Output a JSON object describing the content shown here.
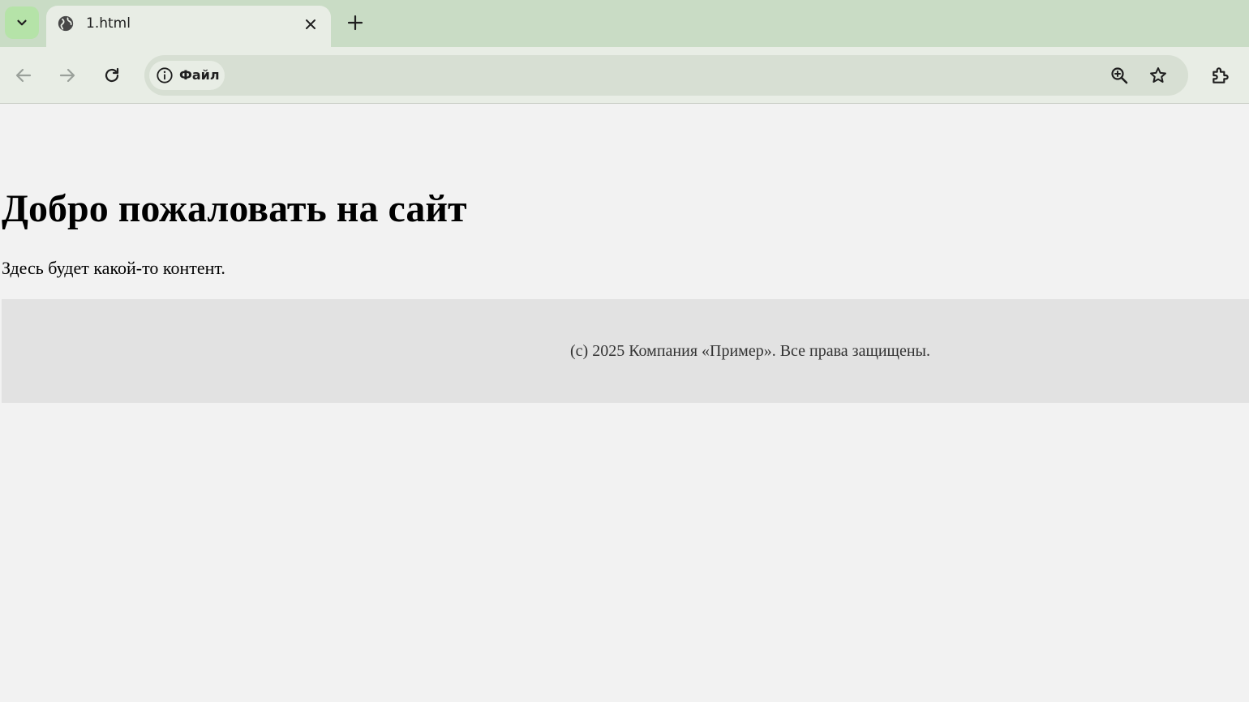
{
  "browser": {
    "tab": {
      "title": "1.html"
    },
    "address_bar": {
      "site_chip_label": "Файл"
    }
  },
  "page": {
    "heading": "Добро пожаловать на сайт",
    "paragraph": "Здесь будет какой-то контент.",
    "footer": "(c) 2025 Компания «Пример». Все права защищены."
  },
  "colors": {
    "tabstrip": "#c9dcc5",
    "toolbar": "#e8ede5",
    "omnibox": "#d7dfd3",
    "page_bg": "#f2f2f2",
    "footer_bg": "#e2e2e2"
  },
  "icons": [
    "chevron-down-icon",
    "globe-icon",
    "close-icon",
    "plus-icon",
    "back-arrow-icon",
    "forward-arrow-icon",
    "reload-icon",
    "info-icon",
    "zoom-icon",
    "star-icon",
    "puzzle-icon"
  ]
}
